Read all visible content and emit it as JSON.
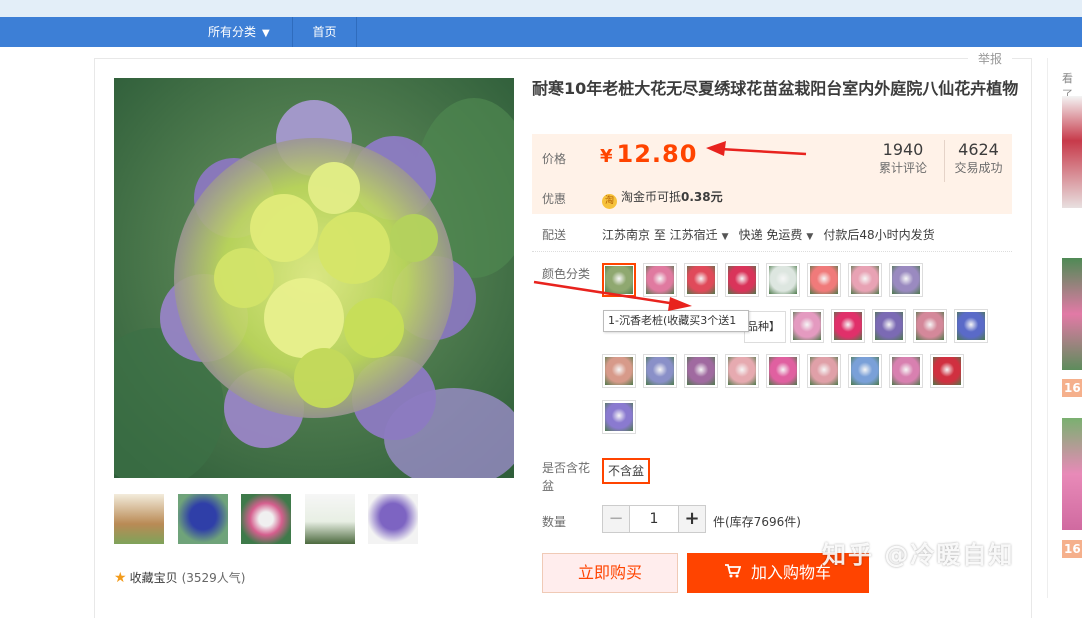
{
  "nav": {
    "all_categories": "所有分类",
    "home": "首页"
  },
  "report": "举报",
  "right_rail": {
    "label": "看了",
    "price_1": "16",
    "price_2": "16"
  },
  "product": {
    "title": "耐寒10年老桩大花无尽夏绣球花苗盆栽阳台室内外庭院八仙花卉植物",
    "price_label": "价格",
    "currency": "¥",
    "price": "12.80",
    "reviews_count": "1940",
    "reviews_label": "累计评论",
    "deals_count": "4624",
    "deals_label": "交易成功",
    "promo_label": "优惠",
    "promo_icon": "淘",
    "promo_text": "淘金币可抵",
    "promo_amount": "0.38元",
    "shipping_label": "配送",
    "ship_from": "江苏南京 至",
    "ship_to": "江苏宿迁",
    "ship_method": "快递 免运费",
    "ship_time": "付款后48小时内发货",
    "color_label": "颜色分类",
    "tooltip": "1-沉香老桩(收藏买3个送1",
    "hidden_option_text": "品种】",
    "pot_label": "是否含花盆",
    "pot_option": "不含盆",
    "qty_label": "数量",
    "qty_minus": "−",
    "qty_value": "1",
    "qty_plus": "+",
    "qty_unit": "件(库存7696件)",
    "buy_now": "立即购买",
    "add_to_cart": "加入购物车",
    "favorite": "收藏宝贝",
    "popularity": "(3529人气)"
  },
  "watermark": "知乎 @冷暖自知",
  "colors": {
    "price_red": "#ff4400",
    "nav_blue": "#3d7fd6",
    "swatches": [
      "#8fa870",
      "#e07aa0",
      "#e04a5a",
      "#d9345a",
      "#dde6e0",
      "#f07a7a",
      "#e8a2b4",
      "#9a8ac0",
      "#e49ac0",
      "#e0306a",
      "#7b6ab4",
      "#d4889a",
      "#5a6ac8",
      "#d79a8a",
      "#8a90c8",
      "#a06aa0",
      "#e6aab0",
      "#e060a0",
      "#e0a0a8",
      "#7aa0d8",
      "#d880b0",
      "#d03040",
      "#8a7ad0"
    ]
  }
}
